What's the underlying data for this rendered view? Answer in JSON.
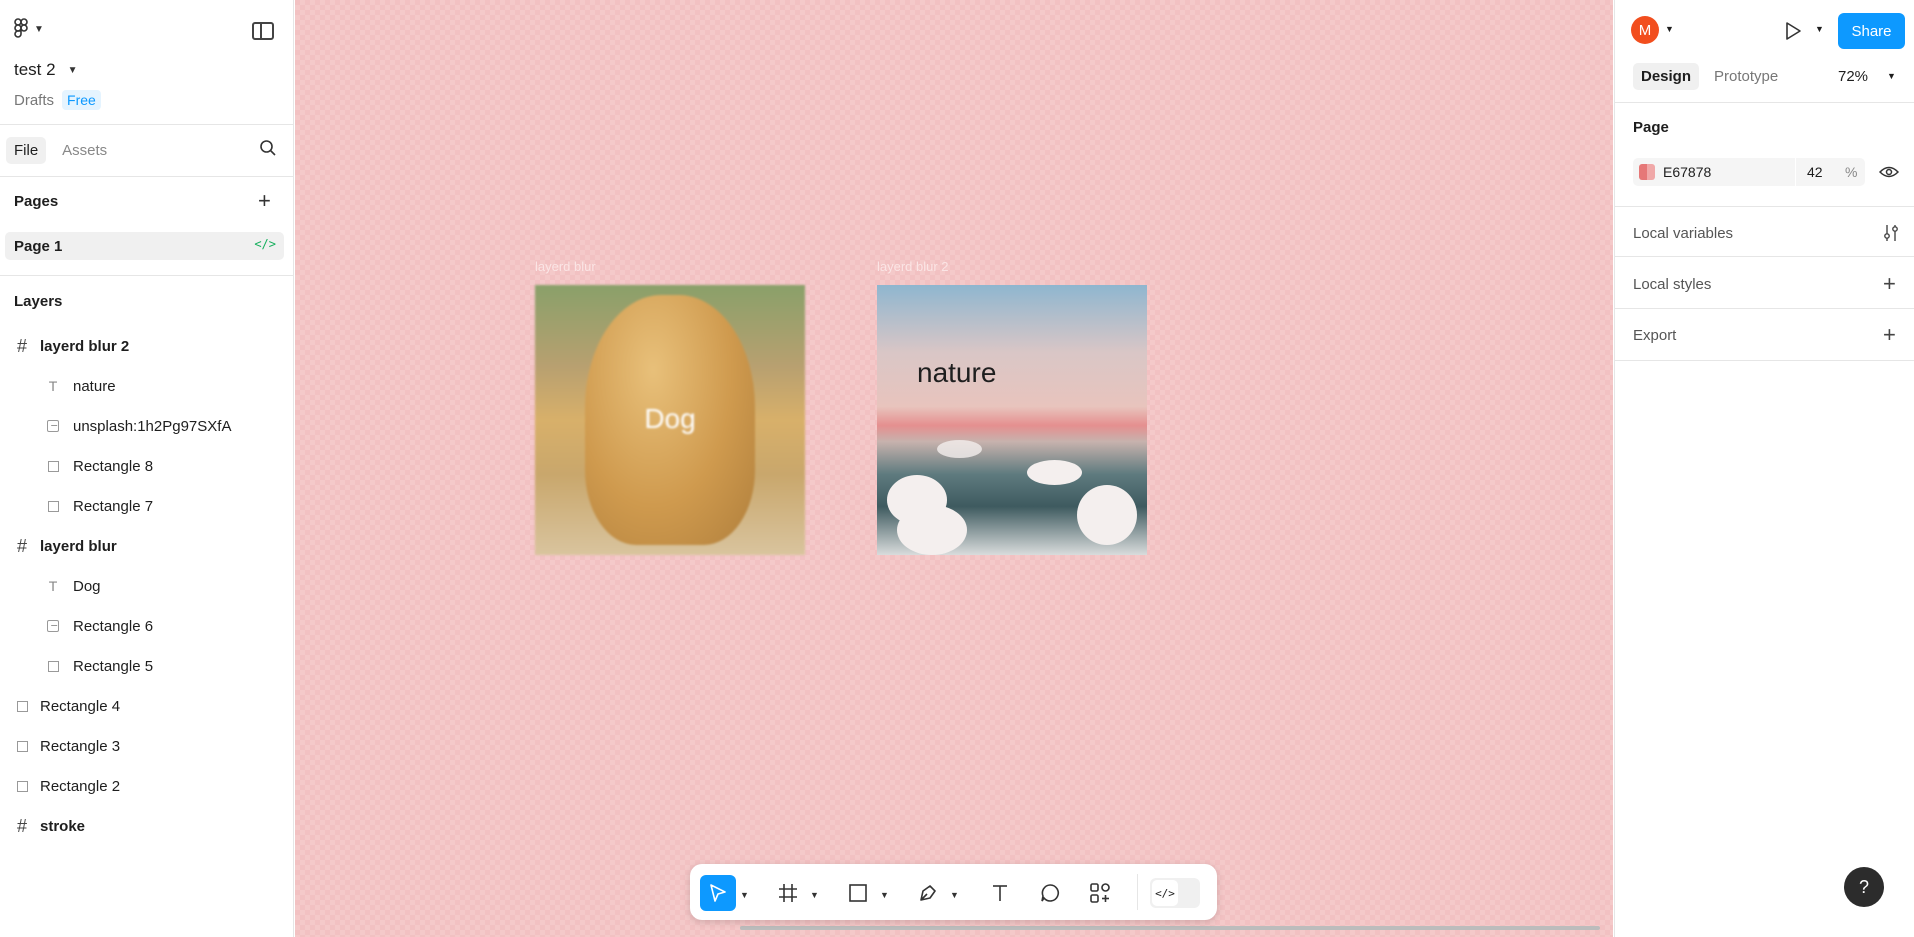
{
  "file": {
    "title": "test 2",
    "location": "Drafts",
    "plan": "Free"
  },
  "left_tabs": [
    "File",
    "Assets"
  ],
  "pages_header": "Pages",
  "pages": [
    {
      "label": "Page 1"
    }
  ],
  "layers_header": "Layers",
  "layers": [
    {
      "label": "layerd blur 2",
      "type": "frame",
      "indent": 0
    },
    {
      "label": "nature",
      "type": "text",
      "indent": 1
    },
    {
      "label": "unsplash:1h2Pg97SXfA",
      "type": "image",
      "indent": 1
    },
    {
      "label": "Rectangle 8",
      "type": "rect",
      "indent": 1
    },
    {
      "label": "Rectangle 7",
      "type": "rect",
      "indent": 1
    },
    {
      "label": "layerd blur",
      "type": "frame",
      "indent": 0
    },
    {
      "label": "Dog",
      "type": "text",
      "indent": 1
    },
    {
      "label": "Rectangle 6",
      "type": "image",
      "indent": 1
    },
    {
      "label": "Rectangle 5",
      "type": "rect",
      "indent": 1
    },
    {
      "label": "Rectangle 4",
      "type": "rect",
      "indent": 0
    },
    {
      "label": "Rectangle 3",
      "type": "rect",
      "indent": 0
    },
    {
      "label": "Rectangle 2",
      "type": "rect",
      "indent": 0
    },
    {
      "label": "stroke",
      "type": "frame",
      "indent": 0
    }
  ],
  "canvas": {
    "background": "#F2C1C2",
    "frames": [
      {
        "label": "layerd blur",
        "text": "Dog"
      },
      {
        "label": "layerd blur 2",
        "text": "nature"
      }
    ]
  },
  "toolbar": {
    "tools": [
      "move",
      "frame",
      "rectangle",
      "pen",
      "text",
      "comment",
      "actions"
    ],
    "active": "move"
  },
  "right": {
    "avatar_initial": "M",
    "share_label": "Share",
    "tabs": [
      "Design",
      "Prototype"
    ],
    "zoom": "72%",
    "page_header": "Page",
    "page_fill_hex": "E67878",
    "page_fill_opacity": "42",
    "percent_sign": "%",
    "local_variables": "Local variables",
    "local_styles": "Local styles",
    "export": "Export"
  },
  "help": "?",
  "colors": {
    "accent": "#0D99FF",
    "avatar": "#F24E1E",
    "page_fill": "#E67878",
    "code_green": "#14AE5C"
  }
}
